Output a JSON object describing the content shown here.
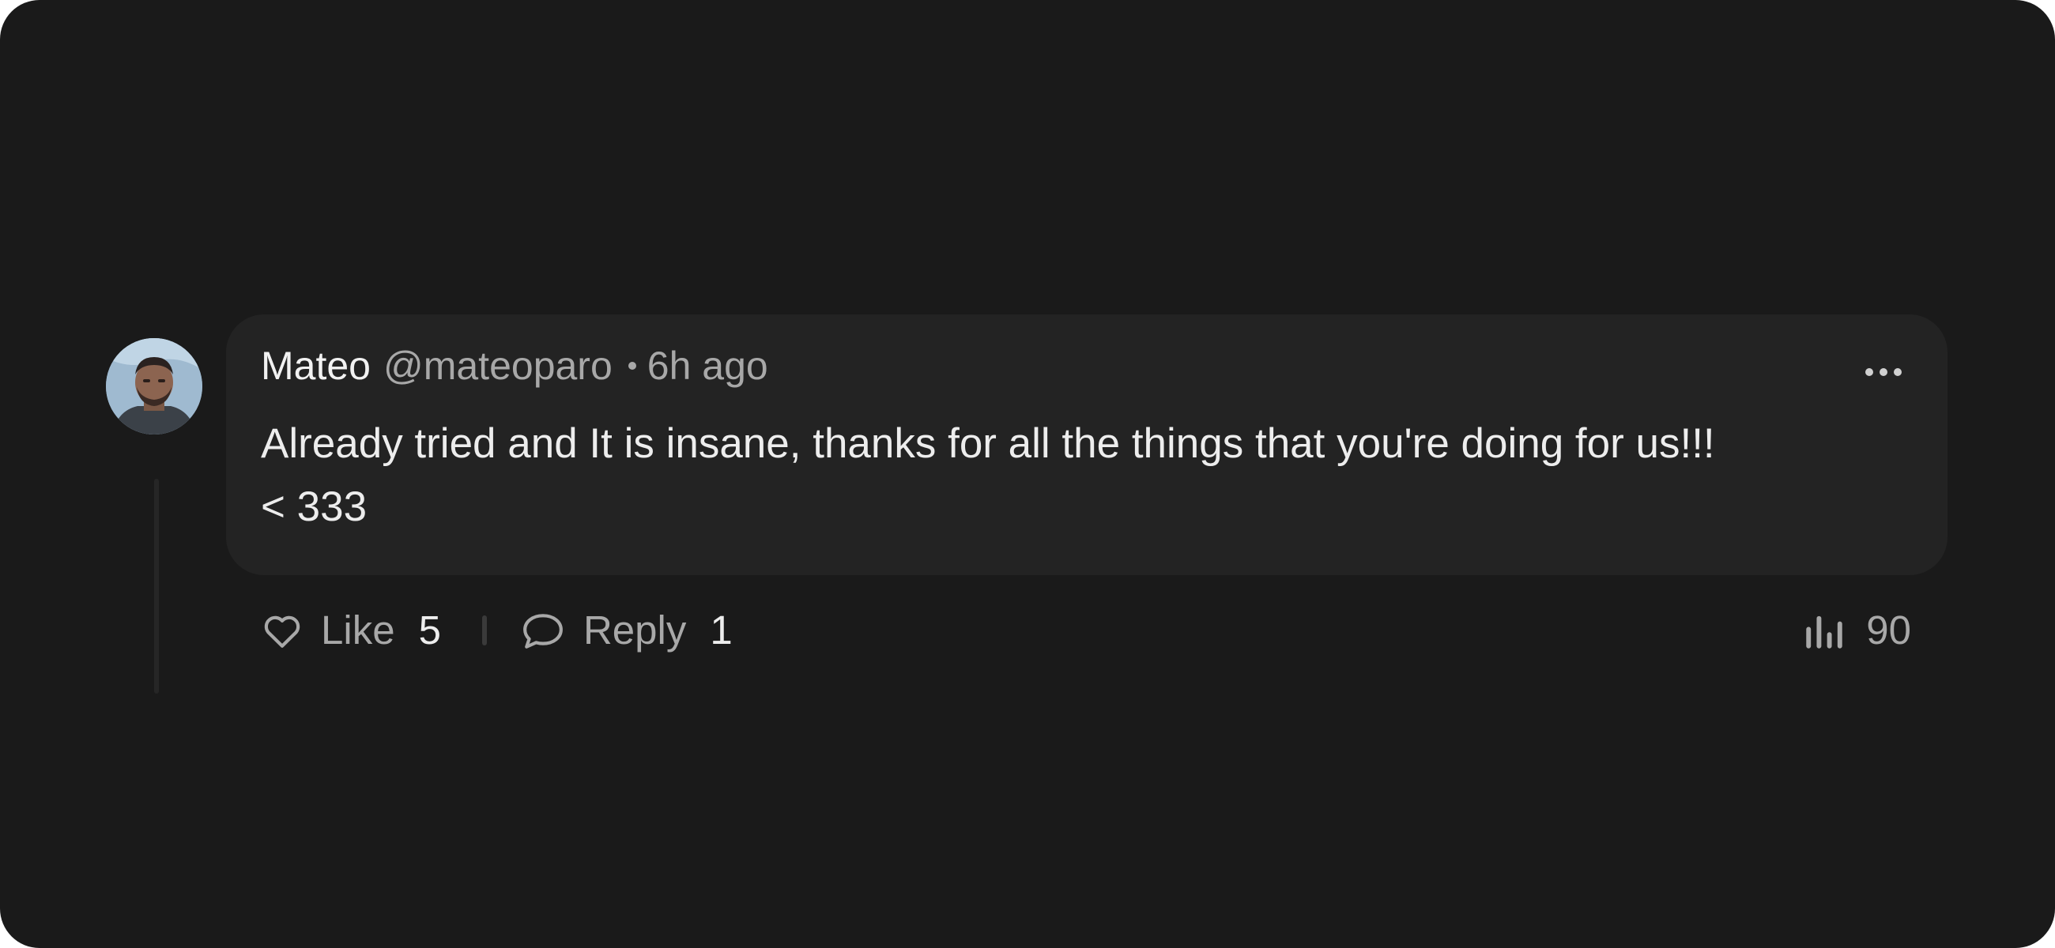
{
  "comment": {
    "author_name": "Mateo",
    "author_handle": "@mateoparo",
    "separator": "•",
    "timestamp": "6h ago",
    "text_line1": "Already tried and It is insane, thanks for all the things that you're doing for us!!!",
    "text_line2": "< 333",
    "likes_label": "Like",
    "likes_count": "5",
    "reply_label": "Reply",
    "reply_count": "1",
    "views_count": "90"
  },
  "icons": {
    "like": "heart-icon",
    "reply": "speech-bubble-icon",
    "views": "bar-chart-icon",
    "more": "ellipsis-icon"
  },
  "colors": {
    "background": "#1a1a1a",
    "card": "#232323",
    "primary_text": "#ededed",
    "secondary_text": "#a8a8a8"
  }
}
